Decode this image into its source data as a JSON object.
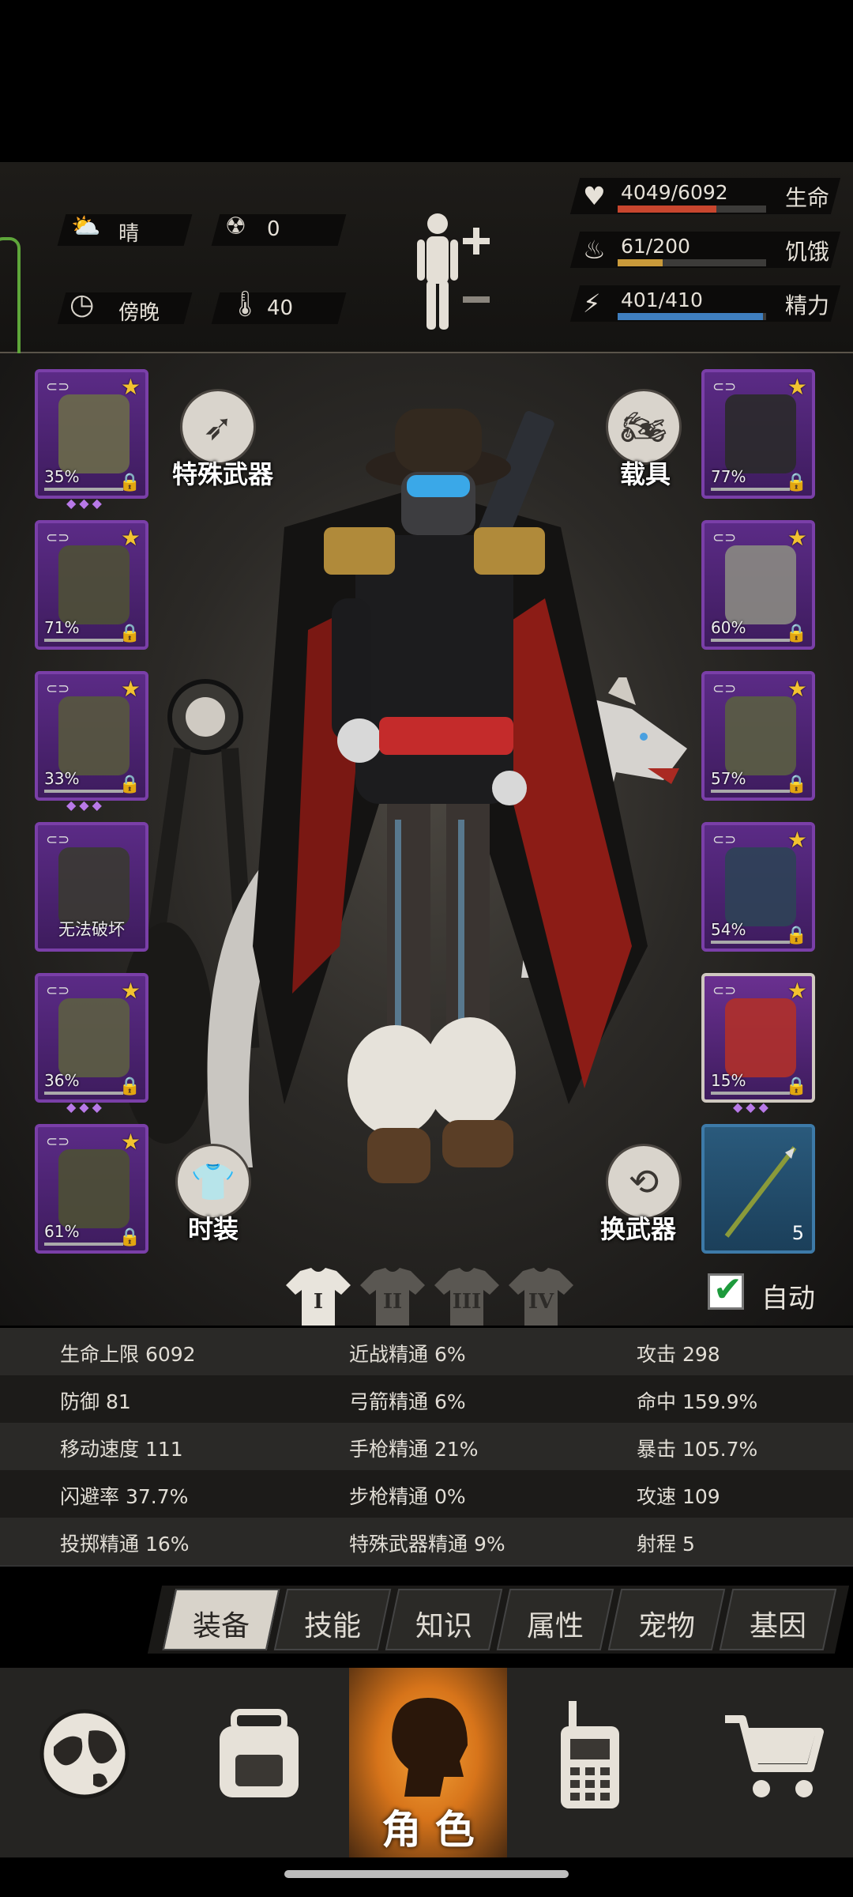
{
  "weather": {
    "icon": "cloud-sun-icon",
    "label": "晴"
  },
  "radiation": {
    "icon": "radiation-icon",
    "value": "0"
  },
  "time_of_day": {
    "icon": "clock-icon",
    "label": "傍晚"
  },
  "temperature": {
    "icon": "thermometer-icon",
    "value": "40"
  },
  "vitals": [
    {
      "icon": "heart-icon",
      "value": "4049/6092",
      "label": "生命",
      "fill": 0.665,
      "color": "#c8462e"
    },
    {
      "icon": "stomach-icon",
      "value": "61/200",
      "label": "饥饿",
      "fill": 0.305,
      "color": "#c99a3a"
    },
    {
      "icon": "energy-icon",
      "value": "401/410",
      "label": "精力",
      "fill": 0.978,
      "color": "#3f7fbf"
    }
  ],
  "left_slots": [
    {
      "name": "helmet",
      "pct": "35%",
      "has_dots": true
    },
    {
      "name": "vest",
      "pct": "71%",
      "has_dots": false
    },
    {
      "name": "jacket",
      "pct": "33%",
      "has_dots": true
    },
    {
      "name": "backpack",
      "pct": "无法破坏",
      "has_dots": false
    },
    {
      "name": "pants",
      "pct": "36%",
      "has_dots": true
    },
    {
      "name": "boots",
      "pct": "61%",
      "has_dots": false
    }
  ],
  "right_slots": [
    {
      "name": "goggles",
      "pct": "77%"
    },
    {
      "name": "gas-mask",
      "pct": "60%"
    },
    {
      "name": "armor-vest",
      "pct": "57%"
    },
    {
      "name": "shield",
      "pct": "54%"
    },
    {
      "name": "pistol",
      "pct": "15%"
    }
  ],
  "ammo_slot": {
    "count": "5"
  },
  "buttons": {
    "special_weapon": "特殊武器",
    "vehicle": "载具",
    "fashion": "时装",
    "switch_weapon": "换武器",
    "auto": "自动"
  },
  "outfit_tabs": [
    "I",
    "II",
    "III",
    "IV"
  ],
  "stats": [
    [
      "生命上限 6092",
      "近战精通 6%",
      "攻击 298"
    ],
    [
      "防御 81",
      "弓箭精通 6%",
      "命中 159.9%"
    ],
    [
      "移动速度 111",
      "手枪精通 21%",
      "暴击 105.7%"
    ],
    [
      "闪避率 37.7%",
      "步枪精通 0%",
      "攻速 109"
    ],
    [
      "投掷精通 16%",
      "特殊武器精通 9%",
      "射程 5"
    ]
  ],
  "tabs": [
    "装备",
    "技能",
    "知识",
    "属性",
    "宠物",
    "基因"
  ],
  "nav": {
    "character_label": "角 色"
  }
}
